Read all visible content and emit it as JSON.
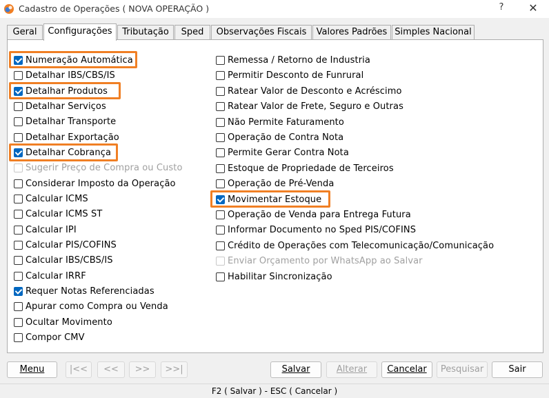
{
  "window": {
    "title": "Cadastro de Operações ( NOVA OPERAÇÃO )",
    "help_label": "?",
    "close_label": "✕"
  },
  "tabs": [
    {
      "label": "Geral",
      "active": false
    },
    {
      "label": "Configurações",
      "active": true
    },
    {
      "label": "Tributação",
      "active": false
    },
    {
      "label": "Sped",
      "active": false
    },
    {
      "label": "Observações Fiscais",
      "active": false
    },
    {
      "label": "Valores Padrões",
      "active": false
    },
    {
      "label": "Simples Nacional",
      "active": false
    }
  ],
  "left_options": [
    {
      "label": "Numeração Automática",
      "checked": true,
      "enabled": true,
      "highlighted": true
    },
    {
      "label": "Detalhar IBS/CBS/IS",
      "checked": false,
      "enabled": true,
      "highlighted": false
    },
    {
      "label": "Detalhar Produtos",
      "checked": true,
      "enabled": true,
      "highlighted": true
    },
    {
      "label": "Detalhar Serviços",
      "checked": false,
      "enabled": true,
      "highlighted": false
    },
    {
      "label": "Detalhar Transporte",
      "checked": false,
      "enabled": true,
      "highlighted": false
    },
    {
      "label": "Detalhar Exportação",
      "checked": false,
      "enabled": true,
      "highlighted": false
    },
    {
      "label": "Detalhar Cobrança",
      "checked": true,
      "enabled": true,
      "highlighted": true
    },
    {
      "label": "Sugerir Preço de Compra ou Custo",
      "checked": false,
      "enabled": false,
      "highlighted": false
    },
    {
      "label": "Considerar Imposto da Operação",
      "checked": false,
      "enabled": true,
      "highlighted": false
    },
    {
      "label": "Calcular ICMS",
      "checked": false,
      "enabled": true,
      "highlighted": false
    },
    {
      "label": "Calcular ICMS ST",
      "checked": false,
      "enabled": true,
      "highlighted": false
    },
    {
      "label": "Calcular IPI",
      "checked": false,
      "enabled": true,
      "highlighted": false
    },
    {
      "label": "Calcular PIS/COFINS",
      "checked": false,
      "enabled": true,
      "highlighted": false
    },
    {
      "label": "Calcular IBS/CBS/IS",
      "checked": false,
      "enabled": true,
      "highlighted": false
    },
    {
      "label": "Calcular IRRF",
      "checked": false,
      "enabled": true,
      "highlighted": false
    },
    {
      "label": "Requer Notas Referenciadas",
      "checked": true,
      "enabled": true,
      "highlighted": false
    },
    {
      "label": "Apurar como Compra ou Venda",
      "checked": false,
      "enabled": true,
      "highlighted": false
    },
    {
      "label": "Ocultar Movimento",
      "checked": false,
      "enabled": true,
      "highlighted": false
    },
    {
      "label": "Compor CMV",
      "checked": false,
      "enabled": true,
      "highlighted": false
    }
  ],
  "right_options": [
    {
      "label": "Remessa / Retorno de Industria",
      "checked": false,
      "enabled": true,
      "highlighted": false
    },
    {
      "label": "Permitir Desconto de Funrural",
      "checked": false,
      "enabled": true,
      "highlighted": false
    },
    {
      "label": "Ratear Valor de Desconto e Acréscimo",
      "checked": false,
      "enabled": true,
      "highlighted": false
    },
    {
      "label": "Ratear Valor de Frete, Seguro e Outras",
      "checked": false,
      "enabled": true,
      "highlighted": false
    },
    {
      "label": "Não Permite Faturamento",
      "checked": false,
      "enabled": true,
      "highlighted": false
    },
    {
      "label": "Operação de Contra Nota",
      "checked": false,
      "enabled": true,
      "highlighted": false
    },
    {
      "label": "Permite Gerar Contra Nota",
      "checked": false,
      "enabled": true,
      "highlighted": false
    },
    {
      "label": "Estoque de Propriedade de Terceiros",
      "checked": false,
      "enabled": true,
      "highlighted": false
    },
    {
      "label": "Operação de Pré-Venda",
      "checked": false,
      "enabled": true,
      "highlighted": false
    },
    {
      "label": "Movimentar Estoque",
      "checked": true,
      "enabled": true,
      "highlighted": true
    },
    {
      "label": "Operação de Venda para Entrega Futura",
      "checked": false,
      "enabled": true,
      "highlighted": false
    },
    {
      "label": "Informar Documento no Sped PIS/COFINS",
      "checked": false,
      "enabled": true,
      "highlighted": false
    },
    {
      "label": "Crédito de Operações com Telecomunicação/Comunicação",
      "checked": false,
      "enabled": true,
      "highlighted": false
    },
    {
      "label": "Enviar Orçamento por WhatsApp ao Salvar",
      "checked": false,
      "enabled": false,
      "highlighted": false
    },
    {
      "label": "Habilitar Sincronização",
      "checked": false,
      "enabled": true,
      "highlighted": false
    }
  ],
  "buttons": {
    "menu": "Menu",
    "first": "|<<",
    "prev": "<<",
    "next": ">>",
    "last": ">>|",
    "salvar": "Salvar",
    "alterar": "Alterar",
    "cancelar": "Cancelar",
    "pesquisar": "Pesquisar",
    "sair": "Sair"
  },
  "status_bar": "F2 ( Salvar )  -  ESC ( Cancelar )",
  "colors": {
    "highlight": "#f07f24",
    "checkbox_checked": "#0067c0"
  }
}
